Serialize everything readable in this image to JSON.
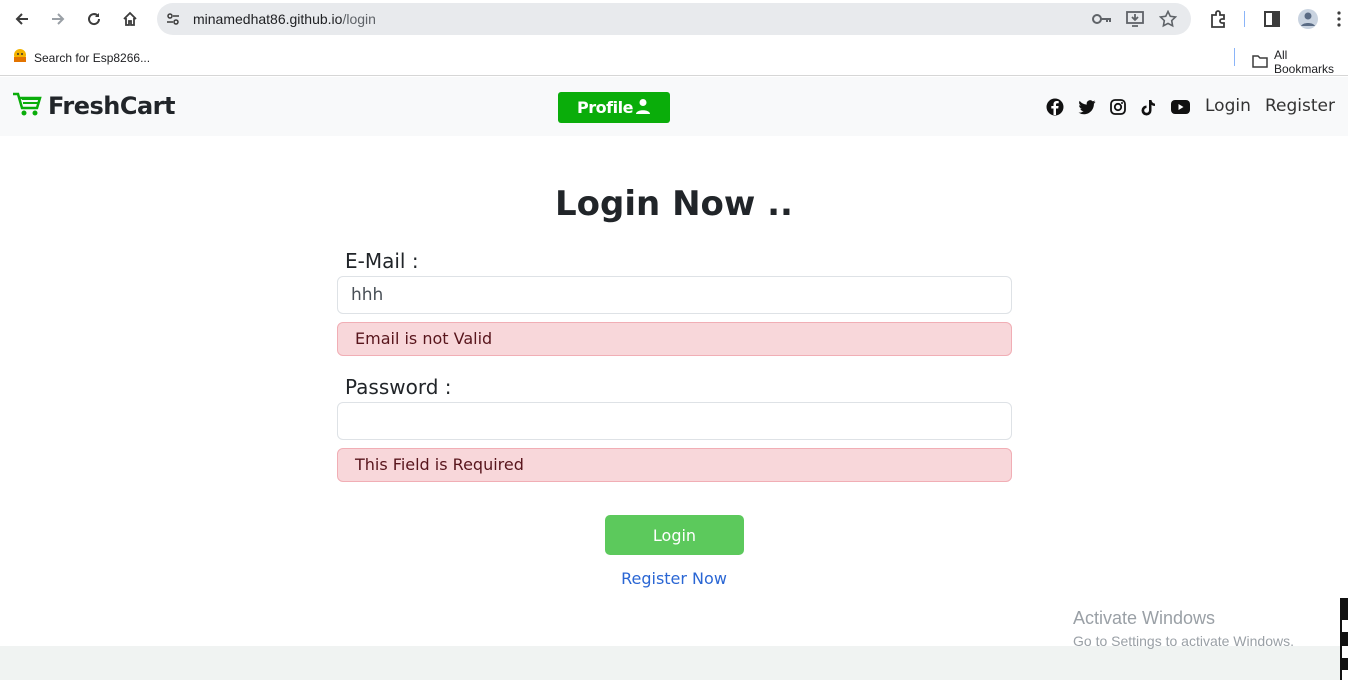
{
  "browser": {
    "url_host": "minamedhat86.github.io",
    "url_path": "/login",
    "bookmarks": [
      {
        "label": "Search for Esp8266..."
      }
    ],
    "all_bookmarks_label": "All Bookmarks"
  },
  "navbar": {
    "brand": "FreshCart",
    "profile_label": "Profile",
    "social_icons": [
      "facebook-icon",
      "twitter-icon",
      "instagram-icon",
      "tiktok-icon",
      "youtube-icon"
    ],
    "login_label": "Login",
    "register_label": "Register"
  },
  "form": {
    "title": "Login Now ..",
    "email_label": "E-Mail :",
    "email_value": "hhh",
    "email_error": "Email is not Valid",
    "password_label": "Password :",
    "password_value": "",
    "password_error": "This Field is Required",
    "submit_label": "Login",
    "register_link": "Register Now"
  },
  "windows": {
    "activate_title": "Activate Windows",
    "activate_sub": "Go to Settings to activate Windows."
  },
  "colors": {
    "brand_green": "#0aad0a",
    "alert_bg": "#f8d7da",
    "link_blue": "#2a66d4"
  }
}
